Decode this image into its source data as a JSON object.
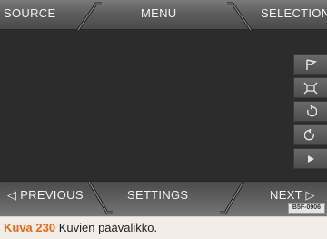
{
  "top_bar": {
    "source_label": "SOURCE",
    "menu_label": "MENU",
    "selection_label": "SELECTION"
  },
  "bottom_bar": {
    "previous_label": "◁  PREVIOUS",
    "settings_label": "SETTINGS",
    "next_label": "NEXT  ▷"
  },
  "side_buttons": [
    {
      "icon": "flag-icon"
    },
    {
      "icon": "fit-to-screen-icon"
    },
    {
      "icon": "rotate-left-icon"
    },
    {
      "icon": "rotate-right-icon"
    },
    {
      "icon": "play-icon"
    }
  ],
  "badge": "B5F-0906",
  "caption": {
    "figure_label": "Kuva 230",
    "text": "Kuvien päävalikko."
  },
  "colors": {
    "screen_bg": "#2c2c2c",
    "caption_accent": "#e56a1e",
    "caption_bg": "#f2ede6"
  }
}
